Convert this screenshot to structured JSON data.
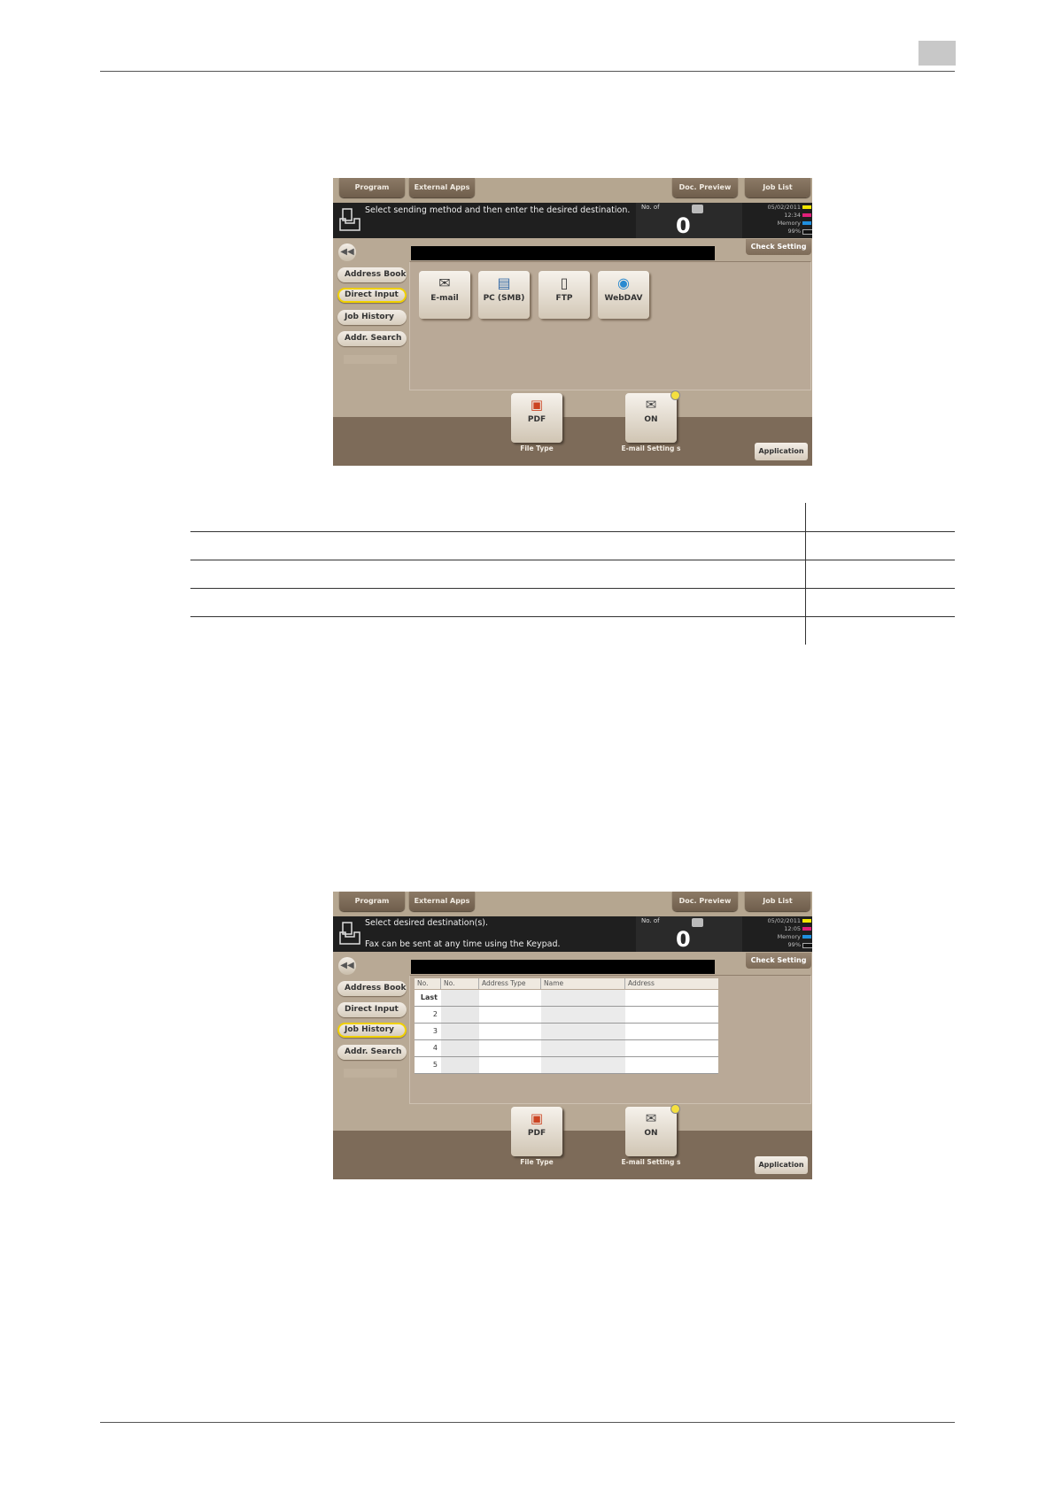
{
  "screen_common": {
    "top_buttons": [
      "Program",
      "External Apps",
      "Doc. Preview",
      "Job List"
    ],
    "counter_label": "No. of",
    "counter_value": "0",
    "check_setting": "Check Setting",
    "left_menu": [
      "Address Book",
      "Direct Input",
      "Job History",
      "Addr. Search"
    ],
    "toner_labels": [
      "Y",
      "M",
      "C",
      "K"
    ],
    "toner_colors": [
      "#f2e600",
      "#e0207a",
      "#2090e0",
      "#111111"
    ],
    "memory_label": "Memory",
    "memory_value": "99%",
    "file_type_value": "PDF",
    "file_type_label": "File Type",
    "email_setting_value": "ON",
    "email_setting_label": "E-mail Setting s",
    "application": "Application"
  },
  "screen1": {
    "message": "Select sending method and then enter the desired destination.",
    "date": "05/02/2011",
    "time": "12:34",
    "active_menu": "Direct Input",
    "methods": [
      {
        "label": "E-mail",
        "icon": "envelope-icon"
      },
      {
        "label": "PC (SMB)",
        "icon": "computer-icon"
      },
      {
        "label": "FTP",
        "icon": "server-icon"
      },
      {
        "label": "WebDAV",
        "icon": "webdav-icon"
      }
    ]
  },
  "screen2": {
    "message_line1": "Select desired destination(s).",
    "message_line2": "Fax can be sent at any time using the Keypad.",
    "date": "05/02/2011",
    "time": "12:05",
    "active_menu": "Job History",
    "columns": [
      "No.",
      "No.",
      "Address Type",
      "Name",
      "Address"
    ],
    "rows": [
      "Last",
      "2",
      "3",
      "4",
      "5"
    ]
  }
}
